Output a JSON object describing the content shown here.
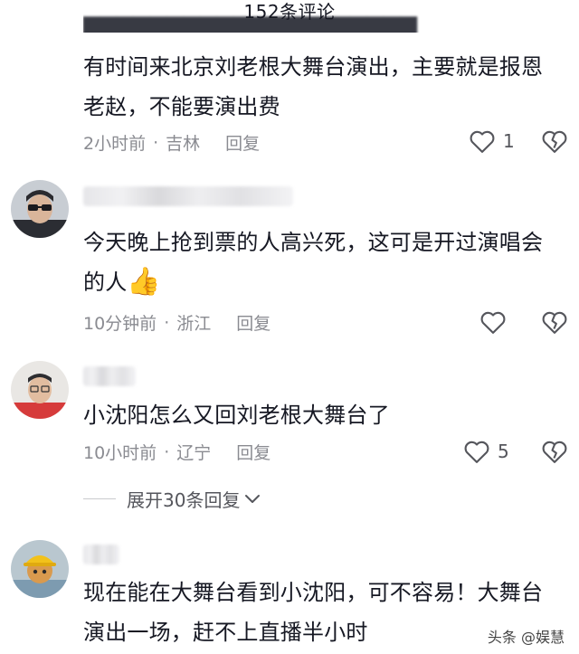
{
  "header": {
    "title": "152条评论"
  },
  "comments": [
    {
      "lines": [
        "有时间来北京刘老根大舞台演出，主要就是报恩",
        "老赵，不能要演出费"
      ],
      "time": "2小时前",
      "location": "吉林",
      "reply_label": "回复",
      "likes": "1"
    },
    {
      "lines": [
        "今天晚上抢到票的人高兴死，这可是开过演唱会",
        "的人"
      ],
      "emoji": "👍",
      "time": "10分钟前",
      "location": "浙江",
      "reply_label": "回复",
      "likes": ""
    },
    {
      "lines": [
        "小沈阳怎么又回刘老根大舞台了"
      ],
      "time": "10小时前",
      "location": "辽宁",
      "reply_label": "回复",
      "likes": "5"
    },
    {
      "lines": [
        "现在能在大舞台看到小沈阳，可不容易！大舞台",
        "演出一场，赶不上直播半小时"
      ]
    }
  ],
  "expand_replies": {
    "label": "展开30条回复"
  },
  "watermark": "头条 @娱慧",
  "colors": {
    "text": "#161823",
    "meta": "#8a8b91",
    "icon": "#55565c"
  },
  "icons": [
    "heart-icon",
    "broken-heart-icon",
    "chevron-down-icon"
  ]
}
